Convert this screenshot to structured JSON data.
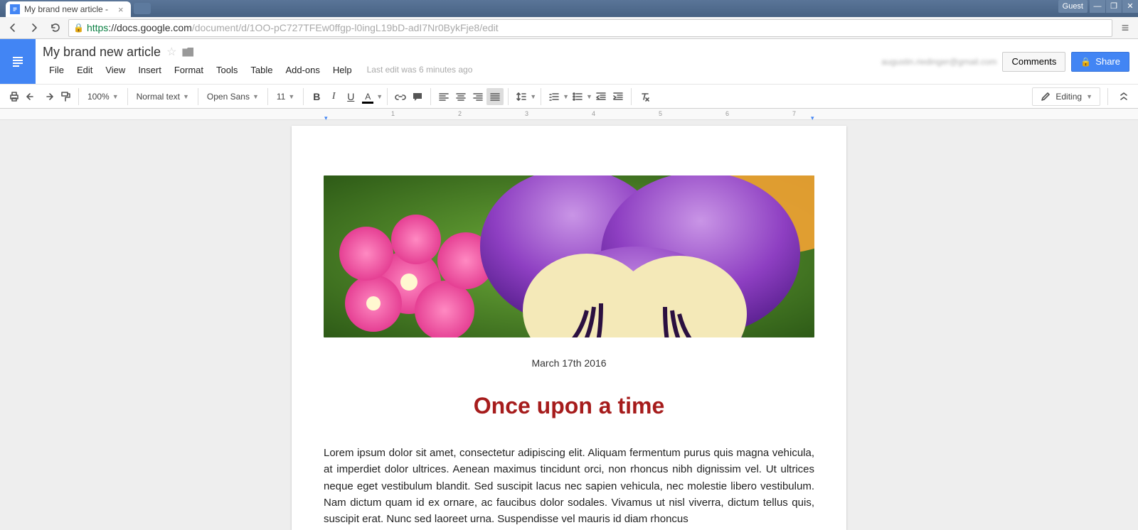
{
  "browser": {
    "tab_title": "My brand new article - ",
    "guest_label": "Guest",
    "url_https": "https",
    "url_domain": "://docs.google.com",
    "url_path": "/document/d/1OO-pC727TFEw0ffgp-l0ingL19bD-adI7Nr0BykFje8/edit"
  },
  "header": {
    "doc_title": "My brand new article",
    "user_email": "augustin.riedinger@gmail.com",
    "comments_label": "Comments",
    "share_label": "Share",
    "last_edit": "Last edit was 6 minutes ago",
    "menus": [
      "File",
      "Edit",
      "View",
      "Insert",
      "Format",
      "Tools",
      "Table",
      "Add-ons",
      "Help"
    ]
  },
  "toolbar": {
    "zoom": "100%",
    "style": "Normal text",
    "font": "Open Sans",
    "size": "11",
    "mode_label": "Editing"
  },
  "ruler": {
    "marks": [
      "1",
      "2",
      "3",
      "4",
      "5",
      "6",
      "7"
    ]
  },
  "document": {
    "date": "March 17th 2016",
    "heading": "Once upon a time",
    "paragraph": "Lorem ipsum dolor sit amet, consectetur adipiscing elit. Aliquam fermentum purus quis magna vehicula, at imperdiet dolor ultrices. Aenean maximus tincidunt orci, non rhoncus nibh dignissim vel. Ut ultrices neque eget vestibulum blandit. Sed suscipit lacus nec sapien vehicula, nec molestie libero vestibulum. Nam dictum quam id ex ornare, ac faucibus dolor sodales. Vivamus ut nisl viverra, dictum tellus quis, suscipit erat. Nunc sed laoreet urna. Suspendisse vel mauris id diam rhoncus"
  }
}
